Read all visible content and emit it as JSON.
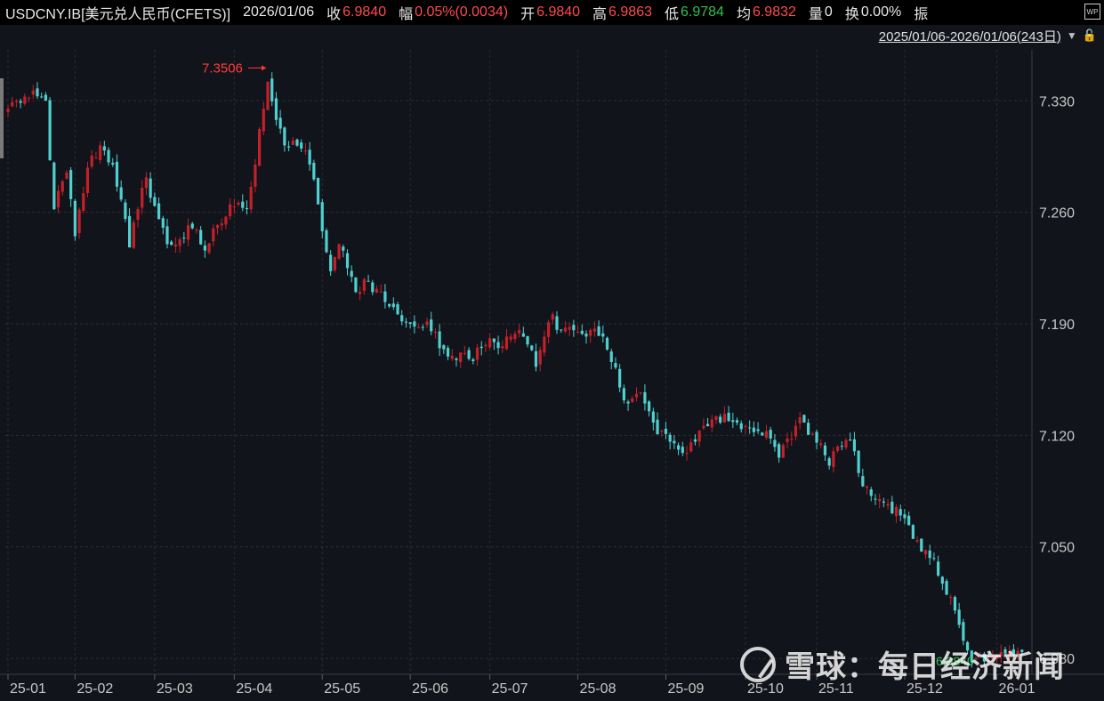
{
  "quote_bar": {
    "symbol": "USDCNY.IB[美元兑人民币(CFETS)]",
    "date": "2026/01/06",
    "close_label": "收",
    "close_value": "6.9840",
    "change_label": "幅",
    "change_value": "0.05%(0.0034)",
    "open_label": "开",
    "open_value": "6.9840",
    "high_label": "高",
    "high_value": "6.9863",
    "low_label": "低",
    "low_value": "6.9784",
    "avg_label": "均",
    "avg_value": "6.9832",
    "volume_label": "量",
    "volume_value": "0",
    "turnover_label": "换",
    "turnover_value": "0.00%",
    "amplitude_label": "振",
    "wp_icon_label": "WP"
  },
  "range_selector": {
    "text": "2025/01/06-2026/01/06(243日)",
    "arrow_icon": "triangle-down-icon",
    "lock_icon": "lock-icon"
  },
  "colors": {
    "up": "#c4202a",
    "down": "#4fd0d0",
    "grid": "#2a2d36",
    "axis_text": "#c8c8c8",
    "annotation": "#ff3a3a",
    "last_label": "#2ec04f"
  },
  "chart_data": {
    "type": "candlestick",
    "title": "USDCNY.IB[美元兑人民币(CFETS)]",
    "y_ticks": [
      7.33,
      7.26,
      7.19,
      7.12,
      7.05,
      6.98
    ],
    "y_tick_labels": [
      "7.330",
      "7.260",
      "7.190",
      "7.120",
      "7.050",
      "6.980"
    ],
    "ylim": [
      6.97,
      7.362
    ],
    "x_tick_labels": [
      "25-01",
      "25-02",
      "25-03",
      "25-04",
      "25-05",
      "25-06",
      "25-07",
      "25-08",
      "25-09",
      "25-10",
      "25-11",
      "25-12",
      "26-01"
    ],
    "x_tick_days": [
      0,
      16,
      35,
      54,
      75,
      96,
      115,
      136,
      157,
      176,
      193,
      214,
      236
    ],
    "total_days": 243,
    "grid": true,
    "max_annotation": {
      "label": "7.3506",
      "value": 7.3506,
      "day": 62
    },
    "last_label": "6.9840",
    "anchors": [
      [
        0,
        7.325
      ],
      [
        2,
        7.33
      ],
      [
        5,
        7.332
      ],
      [
        9,
        7.33
      ],
      [
        11,
        7.262
      ],
      [
        14,
        7.285
      ],
      [
        16,
        7.245
      ],
      [
        19,
        7.288
      ],
      [
        22,
        7.302
      ],
      [
        25,
        7.29
      ],
      [
        27,
        7.268
      ],
      [
        29,
        7.238
      ],
      [
        31,
        7.262
      ],
      [
        33,
        7.282
      ],
      [
        35,
        7.264
      ],
      [
        38,
        7.24
      ],
      [
        41,
        7.243
      ],
      [
        44,
        7.25
      ],
      [
        47,
        7.236
      ],
      [
        50,
        7.252
      ],
      [
        53,
        7.265
      ],
      [
        55,
        7.266
      ],
      [
        57,
        7.262
      ],
      [
        59,
        7.29
      ],
      [
        61,
        7.325
      ],
      [
        62,
        7.342
      ],
      [
        64,
        7.318
      ],
      [
        66,
        7.302
      ],
      [
        68,
        7.305
      ],
      [
        70,
        7.3
      ],
      [
        72,
        7.29
      ],
      [
        74,
        7.265
      ],
      [
        76,
        7.235
      ],
      [
        77,
        7.223
      ],
      [
        79,
        7.24
      ],
      [
        81,
        7.225
      ],
      [
        83,
        7.21
      ],
      [
        85,
        7.218
      ],
      [
        88,
        7.212
      ],
      [
        91,
        7.201
      ],
      [
        93,
        7.196
      ],
      [
        96,
        7.19
      ],
      [
        99,
        7.188
      ],
      [
        102,
        7.185
      ],
      [
        104,
        7.174
      ],
      [
        106,
        7.17
      ],
      [
        108,
        7.172
      ],
      [
        110,
        7.168
      ],
      [
        112,
        7.175
      ],
      [
        115,
        7.181
      ],
      [
        118,
        7.176
      ],
      [
        120,
        7.182
      ],
      [
        122,
        7.186
      ],
      [
        124,
        7.177
      ],
      [
        126,
        7.163
      ],
      [
        128,
        7.182
      ],
      [
        130,
        7.196
      ],
      [
        132,
        7.186
      ],
      [
        134,
        7.188
      ],
      [
        136,
        7.185
      ],
      [
        138,
        7.182
      ],
      [
        140,
        7.187
      ],
      [
        142,
        7.182
      ],
      [
        144,
        7.166
      ],
      [
        146,
        7.15
      ],
      [
        148,
        7.14
      ],
      [
        150,
        7.146
      ],
      [
        152,
        7.14
      ],
      [
        154,
        7.128
      ],
      [
        156,
        7.123
      ],
      [
        158,
        7.116
      ],
      [
        160,
        7.111
      ],
      [
        162,
        7.109
      ],
      [
        164,
        7.116
      ],
      [
        166,
        7.126
      ],
      [
        168,
        7.13
      ],
      [
        170,
        7.128
      ],
      [
        172,
        7.129
      ],
      [
        174,
        7.128
      ],
      [
        176,
        7.126
      ],
      [
        178,
        7.122
      ],
      [
        180,
        7.12
      ],
      [
        182,
        7.118
      ],
      [
        184,
        7.106
      ],
      [
        186,
        7.118
      ],
      [
        188,
        7.126
      ],
      [
        190,
        7.128
      ],
      [
        192,
        7.121
      ],
      [
        194,
        7.115
      ],
      [
        196,
        7.101
      ],
      [
        198,
        7.113
      ],
      [
        200,
        7.117
      ],
      [
        202,
        7.11
      ],
      [
        204,
        7.088
      ],
      [
        206,
        7.082
      ],
      [
        208,
        7.08
      ],
      [
        210,
        7.077
      ],
      [
        212,
        7.075
      ],
      [
        214,
        7.068
      ],
      [
        216,
        7.055
      ],
      [
        218,
        7.047
      ],
      [
        220,
        7.043
      ],
      [
        222,
        7.032
      ],
      [
        224,
        7.02
      ],
      [
        226,
        7.01
      ],
      [
        227,
        7.001
      ],
      [
        229,
        6.985
      ],
      [
        231,
        6.98
      ],
      [
        232,
        6.982
      ],
      [
        234,
        6.979
      ],
      [
        236,
        6.982
      ],
      [
        238,
        6.983
      ],
      [
        240,
        6.982
      ],
      [
        242,
        6.984
      ]
    ]
  },
  "watermark": {
    "logo_icon": "xueqiu-logo-icon",
    "text": "雪球：每日经济新闻"
  }
}
